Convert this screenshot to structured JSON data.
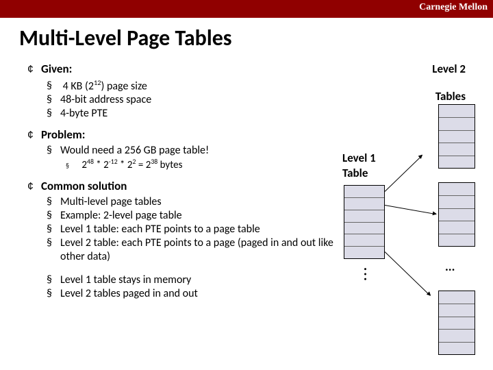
{
  "university": "Carnegie Mellon",
  "title": "Multi-Level Page Tables",
  "sections": {
    "given": {
      "head": "Given:",
      "items": [
        {
          "pre": "4 KB (2",
          "sup": "12",
          "post": ") page size"
        },
        {
          "pre": "48-bit address space",
          "sup": "",
          "post": ""
        },
        {
          "pre": "4-byte PTE",
          "sup": "",
          "post": ""
        }
      ]
    },
    "problem": {
      "head": "Problem:",
      "item": "Would need a 256 GB page table!",
      "calc": {
        "a": "2",
        "ae": "48",
        "b": " * 2",
        "be": "-12",
        "c": " * 2",
        "ce": "2",
        "d": " = 2",
        "de": "38",
        "e": " bytes"
      }
    },
    "solution": {
      "head": "Common solution",
      "items": [
        "Multi-level page tables",
        "Example: 2-level page table",
        "Level 1 table: each PTE points to a page table",
        "Level 2 table: each PTE points to a page (paged in and out like other data)"
      ],
      "notes": [
        "Level 1 table stays in memory",
        "Level 2 tables paged in and out"
      ]
    }
  },
  "diagram": {
    "level2": "Level 2",
    "tables": "Tables",
    "level1": "Level 1",
    "table": "Table",
    "vell": "...",
    "hell": "..."
  }
}
